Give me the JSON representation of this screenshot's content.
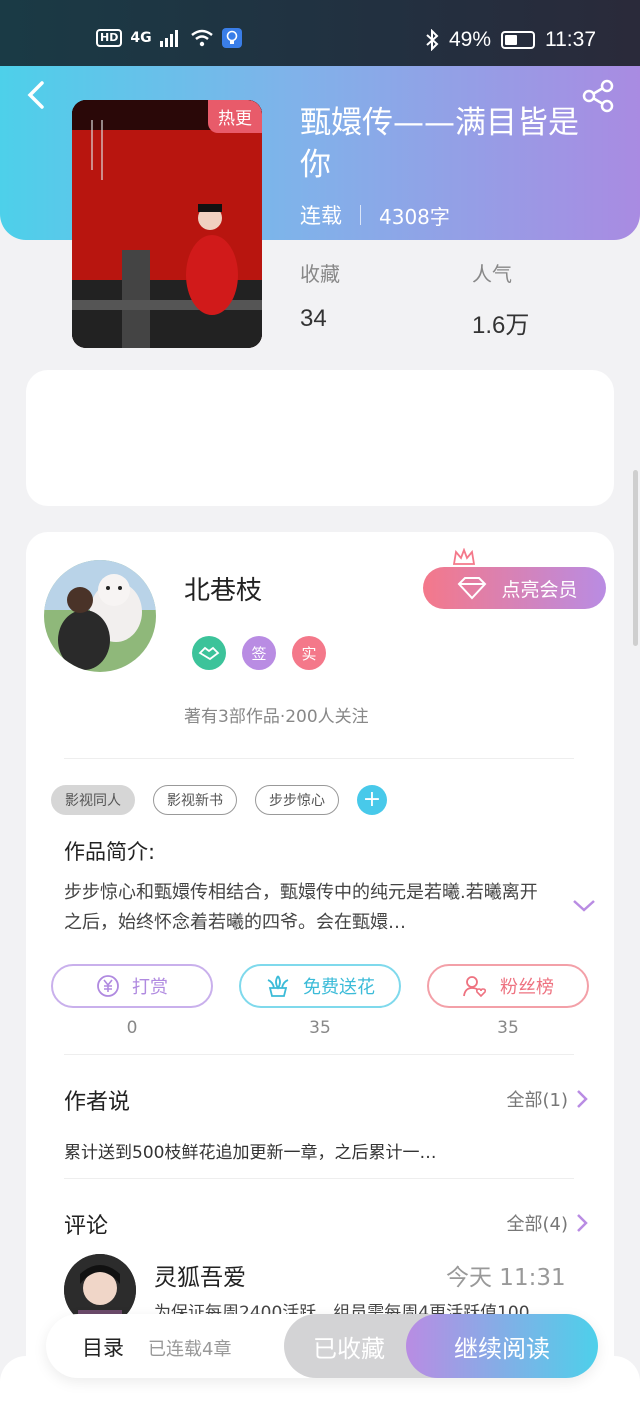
{
  "status_bar": {
    "left_indicator": "HD",
    "network": "4G",
    "battery": "49%",
    "time": "11:37"
  },
  "header": {
    "hot_badge": "热更"
  },
  "book": {
    "title": "甄嬛传——满目皆是你",
    "status": "连载",
    "word_count": "4308字"
  },
  "stats": [
    {
      "label": "收藏",
      "value": "34"
    },
    {
      "label": "人气",
      "value": "1.6万"
    }
  ],
  "author": {
    "name": "北巷枝",
    "badges": [
      "签",
      "实"
    ],
    "summary": "著有3部作品·200人关注",
    "vip_button": "点亮会员"
  },
  "tags": [
    "影视同人",
    "影视新书",
    "步步惊心"
  ],
  "intro": {
    "title": "作品简介:",
    "text": "步步惊心和甄嬛传相结合，甄嬛传中的纯元是若曦.若曦离开之后，始终怀念着若曦的四爷。会在甄嬛…"
  },
  "actions": [
    {
      "label": "打赏",
      "count": "0"
    },
    {
      "label": "免费送花",
      "count": "35"
    },
    {
      "label": "粉丝榜",
      "count": "35"
    }
  ],
  "author_says": {
    "title": "作者说",
    "more": "全部(1)",
    "text": "累计送到500枝鲜花追加更新一章，之后累计一…"
  },
  "comments": {
    "title": "评论",
    "more": "全部(4)",
    "items": [
      {
        "user": "灵狐吾爱",
        "time": "今天 11:31",
        "text": "为保证每周2400活跃，组员需每周4更活跃值100"
      }
    ]
  },
  "bottom_bar": {
    "toc": "目录",
    "toc_status": "已连载4章",
    "favorited": "已收藏",
    "continue": "继续阅读"
  },
  "colors": {
    "accent_cyan": "#4dd0ea",
    "accent_purple": "#a98be2",
    "pink": "#f4788a",
    "green": "#3cc39a"
  }
}
